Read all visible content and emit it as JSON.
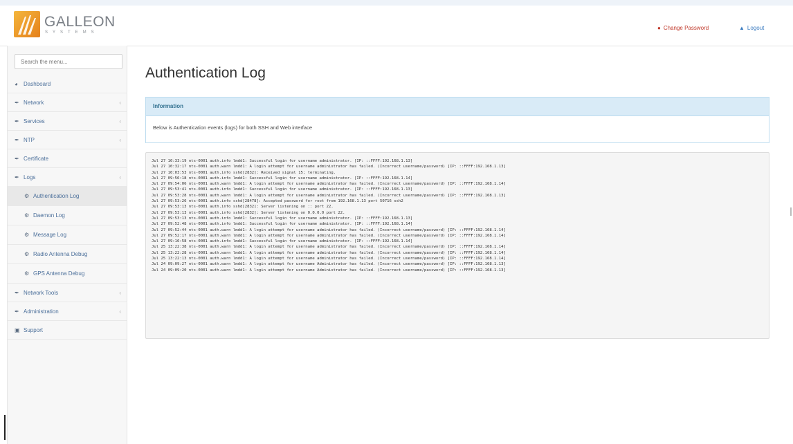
{
  "header": {
    "brand_name": "GALLEON",
    "brand_sub": "SYSTEMS",
    "change_password": "Change Password",
    "logout": "Logout"
  },
  "sidebar": {
    "search_placeholder": "Search the menu...",
    "items": [
      {
        "label": "Dashboard",
        "icon": "dashboard-icon",
        "arrow": false
      },
      {
        "label": "Network",
        "icon": "wrench-icon",
        "arrow": true
      },
      {
        "label": "Services",
        "icon": "wrench-icon",
        "arrow": true
      },
      {
        "label": "NTP",
        "icon": "wrench-icon",
        "arrow": true
      },
      {
        "label": "Certificate",
        "icon": "wrench-icon",
        "arrow": false
      },
      {
        "label": "Logs",
        "icon": "wrench-icon",
        "arrow": true
      },
      {
        "label": "Authentication Log",
        "icon": "gear-icon",
        "sub": true,
        "active": true
      },
      {
        "label": "Daemon Log",
        "icon": "gear-icon",
        "sub": true
      },
      {
        "label": "Message Log",
        "icon": "gear-icon",
        "sub": true
      },
      {
        "label": "Radio Antenna Debug",
        "icon": "gear-icon",
        "sub": true
      },
      {
        "label": "GPS Antenna Debug",
        "icon": "gear-icon",
        "sub": true
      },
      {
        "label": "Network Tools",
        "icon": "wrench-icon",
        "arrow": true
      },
      {
        "label": "Administration",
        "icon": "wrench-icon",
        "arrow": true
      },
      {
        "label": "Support",
        "icon": "support-icon",
        "arrow": false
      }
    ]
  },
  "main": {
    "title": "Authentication Log",
    "panel_heading": "Information",
    "panel_text": "Below is Authentication events (logs) for both SSH and Web interface"
  },
  "log": [
    "Jul 27 10:33:19 nts-0001 auth.info lmdd1: Successful login for username administrator. [IP: ::FFFF:192.168.1.13]",
    "Jul 27 10:32:17 nts-0001 auth.warn lmdd1: A login attempt for username administrator has failed. (Incorrect username/password) [IP: ::FFFF:192.168.1.13]",
    "Jul 27 10:03:53 nts-0001 auth.info sshd[2832]: Received signal 15; terminating.",
    "Jul 27 09:56:18 nts-0001 auth.info lmdd1: Successful login for username administrator. [IP: ::FFFF:192.168.1.14]",
    "Jul 27 09:54:06 nts-0001 auth.warn lmdd1: A login attempt for username administrator has failed. (Incorrect username/password) [IP: ::FFFF:192.168.1.14]",
    "Jul 27 09:53:41 nts-0001 auth.info lmdd1: Successful login for username administrator. [IP: ::FFFF:192.168.1.13]",
    "Jul 27 09:53:28 nts-0001 auth.warn lmdd1: A login attempt for username administrator has failed. (Incorrect username/password) [IP: ::FFFF:192.168.1.13]",
    "Jul 27 09:53:26 nts-0001 auth.info sshd[28478]: Accepted password for root from 192.168.1.13 port 50716 ssh2",
    "Jul 27 09:53:13 nts-0001 auth.info sshd[2832]: Server listening on :: port 22.",
    "Jul 27 09:53:13 nts-0001 auth.info sshd[2832]: Server listening on 0.0.0.0 port 22.",
    "Jul 27 09:53:13 nts-0001 auth.info lmdd1: Successful login for username administrator. [IP: ::FFFF:192.168.1.13]",
    "Jul 27 09:52:48 nts-0001 auth.info lmdd1: Successful login for username administrator. [IP: ::FFFF:192.168.1.14]",
    "Jul 27 09:52:44 nts-0001 auth.warn lmdd1: A login attempt for username administrator has failed. (Incorrect username/password) [IP: ::FFFF:192.168.1.14]",
    "Jul 27 09:52:17 nts-0001 auth.warn lmdd1: A login attempt for username administrator has failed. (Incorrect username/password) [IP: ::FFFF:192.168.1.14]",
    "Jul 27 09:16:58 nts-0001 auth.info lmdd1: Successful login for username administrator. [IP: ::FFFF:192.168.1.14]",
    "Jul 25 13:22:38 nts-0001 auth.warn lmdd1: A login attempt for username administrator has failed. (Incorrect username/password) [IP: ::FFFF:192.168.1.14]",
    "Jul 25 13:22:28 nts-0001 auth.warn lmdd1: A login attempt for username administrator has failed. (Incorrect username/password) [IP: ::FFFF:192.168.1.14]",
    "Jul 25 13:22:13 nts-0001 auth.warn lmdd1: A login attempt for username administrator has failed. (Incorrect username/password) [IP: ::FFFF:192.168.1.14]",
    "Jul 24 09:09:27 nts-0001 auth.warn lmdd1: A login attempt for username Administrator has failed. (Incorrect username/password) [IP: ::FFFF:192.168.1.13]",
    "Jul 24 09:09:20 nts-0001 auth.warn lmdd1: A login attempt for username Administrator has failed. (Incorrect username/password) [IP: ::FFFF:192.168.1.13]"
  ],
  "colors": {
    "change_password": "#c0392b",
    "logout": "#3a7bc0",
    "menu_text": "#4b6f9a",
    "panel_heading_bg": "#d9ebf7"
  }
}
